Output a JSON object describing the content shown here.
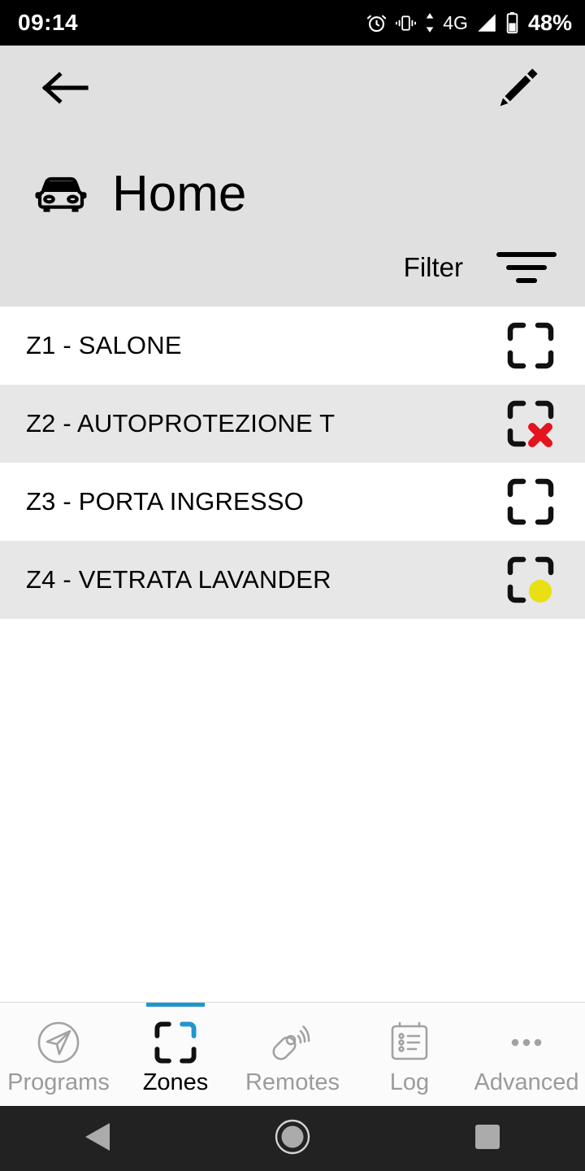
{
  "status_bar": {
    "time": "09:14",
    "network": "4G",
    "battery": "48%",
    "icons": [
      "alarm-clock-icon",
      "vibrate-icon",
      "data-transfer-icon",
      "signal-icon",
      "battery-icon"
    ]
  },
  "header": {
    "back_label": "back-arrow-icon",
    "edit_label": "pencil-icon",
    "title": "Home",
    "title_icon": "car-icon",
    "filter_label": "Filter",
    "filter_icon": "filter-funnel-icon",
    "background": "#e0e0e0"
  },
  "zones": [
    {
      "name": "Z1 - SALONE",
      "state": "normal",
      "badge": "none",
      "striped": false
    },
    {
      "name": "Z2 - AUTOPROTEZIONE T",
      "state": "excluded",
      "badge": "red-cross",
      "striped": true
    },
    {
      "name": "Z3 - PORTA INGRESSO",
      "state": "normal",
      "badge": "none",
      "striped": false
    },
    {
      "name": "Z4 - VETRATA LAVANDER",
      "state": "open",
      "badge": "yellow-dot",
      "striped": true
    }
  ],
  "tabs": [
    {
      "label": "Programs",
      "icon": "paper-plane-circle-icon",
      "active": false
    },
    {
      "label": "Zones",
      "icon": "zone-brackets-icon",
      "active": true
    },
    {
      "label": "Remotes",
      "icon": "key-fob-signal-icon",
      "active": false
    },
    {
      "label": "Log",
      "icon": "clipboard-list-icon",
      "active": false
    },
    {
      "label": "Advanced",
      "icon": "three-dots-icon",
      "active": false
    }
  ],
  "colors": {
    "accent": "#2196ce",
    "alert_red": "#e3141e",
    "warn_yellow": "#e8e012",
    "row_stripe": "#e7e7e7",
    "header_bg": "#e0e0e0",
    "inactive_tab": "#9b9b9b"
  },
  "nav_bar": {
    "back": "triangle-back-icon",
    "home": "circle-home-icon",
    "recents": "square-recents-icon"
  }
}
